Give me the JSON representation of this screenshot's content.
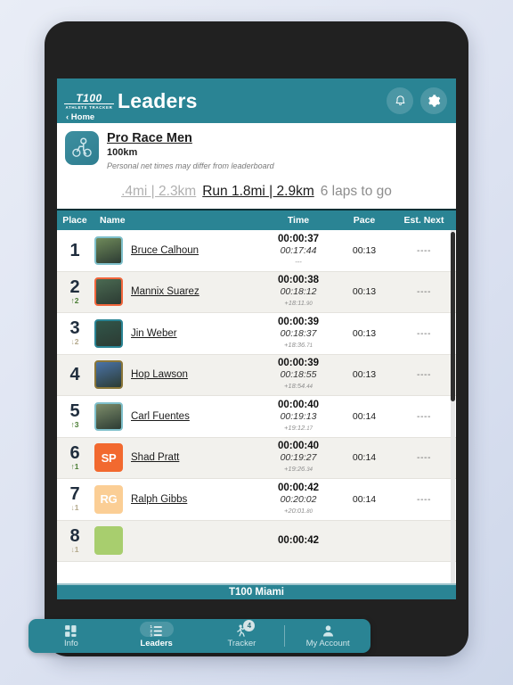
{
  "header": {
    "logo_main": "T100",
    "logo_sub": "ATHLETE TRACKER",
    "title": "Leaders",
    "home_label": "‹ Home",
    "bell_icon": "notification-bell-icon",
    "gear_icon": "settings-gear-icon",
    "bg_color": "#2a8494"
  },
  "race": {
    "icon": "cyclist-icon",
    "name": "Pro Race Men",
    "distance": "100km",
    "note": "Personal net times may differ from leaderboard"
  },
  "segments": {
    "past": ".4mi | 2.3km",
    "current": "Run 1.8mi | 2.9km",
    "laps": "6 laps to go"
  },
  "table": {
    "columns": {
      "place": "Place",
      "name": "Name",
      "time": "Time",
      "pace": "Pace",
      "next": "Est. Next"
    },
    "rows": [
      {
        "place": "1",
        "delta": "",
        "delta_dir": "none",
        "avatar_type": "photo",
        "avatar_initials": "",
        "avatar_bg": "#6f8a5a",
        "avatar_border": "#7fc0cb",
        "name": "Bruce Calhoun",
        "time_main": "00:00:37",
        "time_sub": "00:17:44",
        "gap_whole": "---",
        "gap_frac": "",
        "pace": "00:13",
        "next": "----"
      },
      {
        "place": "2",
        "delta": "2",
        "delta_dir": "up",
        "avatar_type": "photo",
        "avatar_initials": "",
        "avatar_bg": "#4b6a52",
        "avatar_border": "#f2663c",
        "name": "Mannix Suarez",
        "time_main": "00:00:38",
        "time_sub": "00:18:12",
        "gap_whole": "+18:11.",
        "gap_frac": "90",
        "pace": "00:13",
        "next": "----"
      },
      {
        "place": "3",
        "delta": "2",
        "delta_dir": "down",
        "avatar_type": "photo",
        "avatar_initials": "",
        "avatar_bg": "#31564a",
        "avatar_border": "#2a8494",
        "name": "Jin Weber",
        "time_main": "00:00:39",
        "time_sub": "00:18:37",
        "gap_whole": "+18:36.",
        "gap_frac": "71",
        "pace": "00:13",
        "next": "----"
      },
      {
        "place": "4",
        "delta": "",
        "delta_dir": "none",
        "avatar_type": "photo",
        "avatar_initials": "",
        "avatar_bg": "#4a73a8",
        "avatar_border": "#8a7638",
        "name": "Hop Lawson",
        "time_main": "00:00:39",
        "time_sub": "00:18:55",
        "gap_whole": "+18:54.",
        "gap_frac": "44",
        "pace": "00:13",
        "next": "----"
      },
      {
        "place": "5",
        "delta": "3",
        "delta_dir": "up",
        "avatar_type": "photo",
        "avatar_initials": "",
        "avatar_bg": "#7d8d6a",
        "avatar_border": "#7fc0cb",
        "name": "Carl Fuentes",
        "time_main": "00:00:40",
        "time_sub": "00:19:13",
        "gap_whole": "+19:12.",
        "gap_frac": "17",
        "pace": "00:14",
        "next": "----"
      },
      {
        "place": "6",
        "delta": "1",
        "delta_dir": "up",
        "avatar_type": "initials",
        "avatar_initials": "SP",
        "avatar_bg": "#f2692f",
        "avatar_border": "#f2692f",
        "name": "Shad Pratt",
        "time_main": "00:00:40",
        "time_sub": "00:19:27",
        "gap_whole": "+19:26.",
        "gap_frac": "34",
        "pace": "00:14",
        "next": "----"
      },
      {
        "place": "7",
        "delta": "1",
        "delta_dir": "down",
        "avatar_type": "initials",
        "avatar_initials": "RG",
        "avatar_bg": "#fbce95",
        "avatar_border": "#fbce95",
        "name": "Ralph Gibbs",
        "time_main": "00:00:42",
        "time_sub": "00:20:02",
        "gap_whole": "+20:01.",
        "gap_frac": "80",
        "pace": "00:14",
        "next": "----"
      },
      {
        "place": "8",
        "delta": "1",
        "delta_dir": "down",
        "avatar_type": "initials",
        "avatar_initials": "",
        "avatar_bg": "#a8ce6e",
        "avatar_border": "#a8ce6e",
        "name": "",
        "time_main": "00:00:42",
        "time_sub": "",
        "gap_whole": "",
        "gap_frac": "",
        "pace": "",
        "next": ""
      }
    ]
  },
  "bottom_nav": {
    "items": [
      {
        "label": "Info",
        "icon": "grid-tiles-icon",
        "active": false,
        "badge": ""
      },
      {
        "label": "Leaders",
        "icon": "list-numbered-icon",
        "active": true,
        "badge": ""
      },
      {
        "label": "Tracker",
        "icon": "runner-icon",
        "active": false,
        "badge": "4"
      },
      {
        "label": "My Account",
        "icon": "person-icon",
        "active": false,
        "badge": ""
      }
    ]
  },
  "footer": {
    "event_name": "T100 Miami"
  }
}
